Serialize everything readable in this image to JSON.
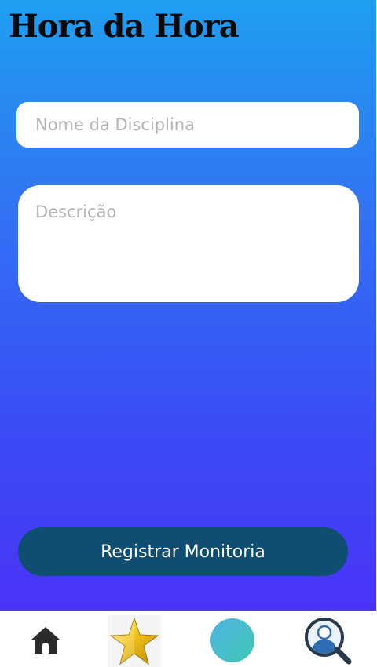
{
  "app": {
    "title": "Hora da Hora"
  },
  "form": {
    "discipline_placeholder": "Nome da Disciplina",
    "description_placeholder": "Descrição",
    "submit_label": "Registrar Monitoria"
  },
  "nav": {
    "items": [
      {
        "icon": "home-icon"
      },
      {
        "icon": "star-icon"
      },
      {
        "icon": "circle-icon"
      },
      {
        "icon": "user-search-icon"
      }
    ]
  },
  "colors": {
    "gradient_top": "#1f9ff0",
    "gradient_bottom": "#4a34f7",
    "button": "#0f4d71",
    "circle_start": "#4fb4e4",
    "circle_end": "#40c7b4"
  }
}
